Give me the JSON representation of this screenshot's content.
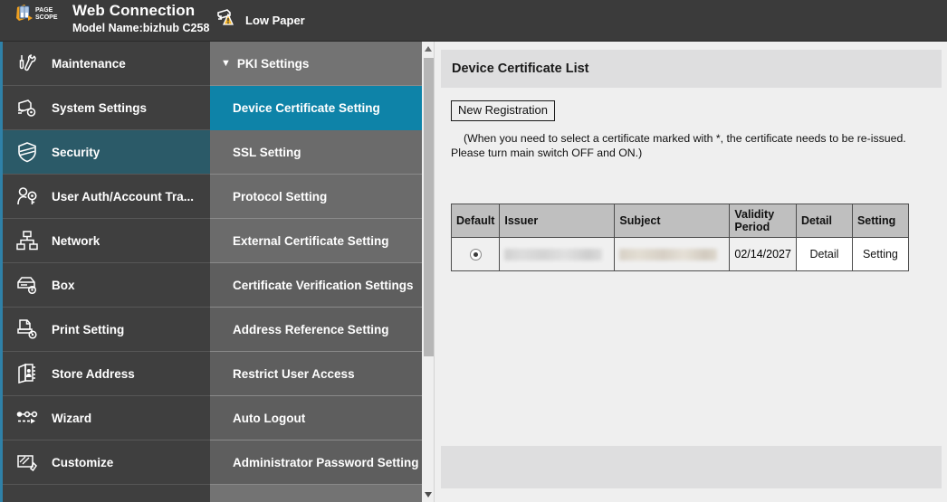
{
  "header": {
    "logo_icon": "pagescope-logo-icon",
    "logo_text_top": "PAGE",
    "logo_text_bottom": "SCOPE",
    "title": "Web Connection",
    "model": "Model Name:bizhub C258",
    "status_icon": "low-paper-warning-icon",
    "status_label": "Low Paper"
  },
  "nav_primary": {
    "items": [
      {
        "label": "Maintenance",
        "icon": "wrench-screwdriver-icon",
        "active": false
      },
      {
        "label": "System Settings",
        "icon": "printer-gear-icon",
        "active": false
      },
      {
        "label": "Security",
        "icon": "shield-icon",
        "active": true
      },
      {
        "label": "User Auth/Account Tra...",
        "icon": "user-key-icon",
        "active": false
      },
      {
        "label": "Network",
        "icon": "network-nodes-icon",
        "active": false
      },
      {
        "label": "Box",
        "icon": "box-gear-icon",
        "active": false
      },
      {
        "label": "Print Setting",
        "icon": "print-gear-icon",
        "active": false
      },
      {
        "label": "Store Address",
        "icon": "address-book-icon",
        "active": false
      },
      {
        "label": "Wizard",
        "icon": "wizard-flow-icon",
        "active": false
      },
      {
        "label": "Customize",
        "icon": "customize-pencil-icon",
        "active": false
      }
    ]
  },
  "nav_secondary": {
    "group_label": "PKI Settings",
    "group_caret": "▼",
    "items": [
      {
        "label": "Device Certificate Setting",
        "active": true
      },
      {
        "label": "SSL Setting",
        "active": false
      },
      {
        "label": "Protocol Setting",
        "active": false
      },
      {
        "label": "External Certificate Setting",
        "active": false
      },
      {
        "label": "Certificate Verification Settings",
        "active": false
      },
      {
        "label": "Address Reference Setting",
        "active": false
      },
      {
        "label": "Restrict User Access",
        "active": false
      },
      {
        "label": "Auto Logout",
        "active": false
      },
      {
        "label": "Administrator Password Setting",
        "active": false
      }
    ]
  },
  "scrollbar": {
    "up_icon": "scroll-up-arrow-icon",
    "down_icon": "scroll-down-arrow-icon"
  },
  "main": {
    "panel_title": "Device Certificate List",
    "new_registration_label": "New Registration",
    "notice_line1": "(When you need to select a certificate marked with *, the certificate needs to be re-issued.",
    "notice_line2": "Please turn main switch OFF and ON.)",
    "table": {
      "headers": [
        "Default",
        "Issuer",
        "Subject",
        "Validity Period",
        "Detail",
        "Setting"
      ],
      "rows": [
        {
          "default_selected": true,
          "issuer": "",
          "subject": "",
          "validity_period": "02/14/2027",
          "detail_label": "Detail",
          "setting_label": "Setting"
        }
      ]
    }
  },
  "colors": {
    "header_bg": "#3b3b3b",
    "nav_primary_bg": "#3f3f3f",
    "nav_primary_active": "#2b5a68",
    "nav_secondary_bg": "#737373",
    "accent_teal": "#0e83a8",
    "content_bg": "#efefef",
    "panel_header_bg": "#dededf",
    "table_header_bg": "#bfbfbf",
    "warning_yellow": "#f5b324"
  }
}
